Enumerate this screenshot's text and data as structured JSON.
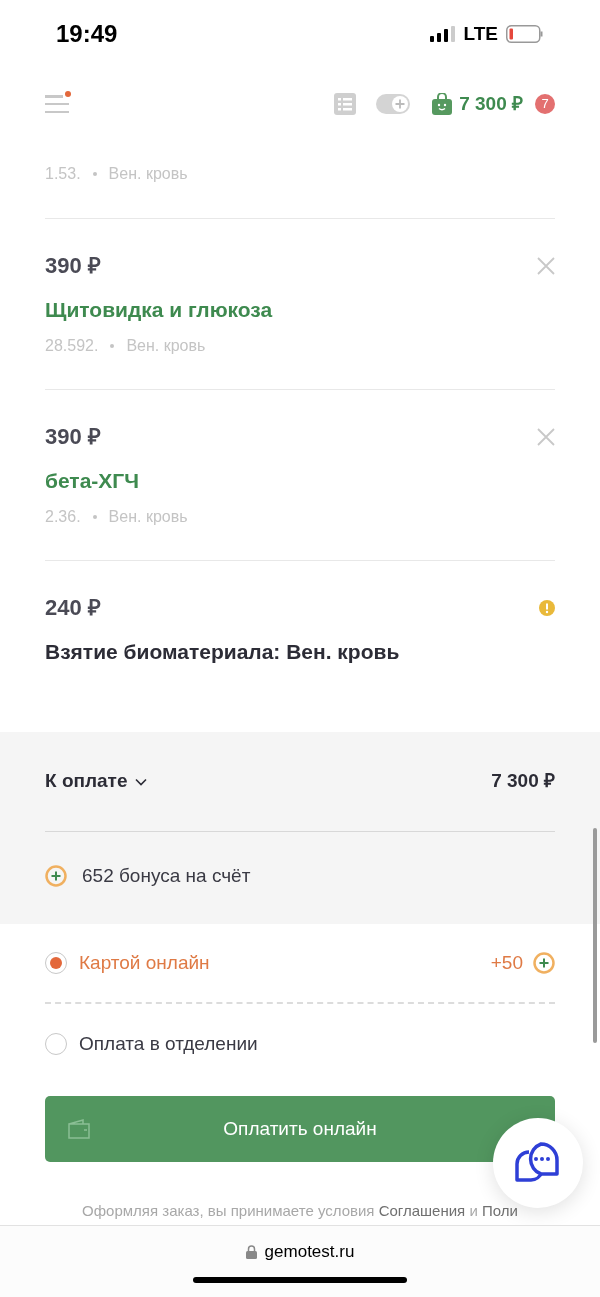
{
  "status_bar": {
    "time": "19:49",
    "network": "LTE"
  },
  "header": {
    "menu_notification": true,
    "cart_total": "7 300 ₽",
    "cart_count": "7"
  },
  "items": [
    {
      "kind": "partial",
      "code": "1.53.",
      "material": "Вен. кровь"
    },
    {
      "kind": "test",
      "price": "390 ₽",
      "title": "Щитовидка и глюкоза",
      "code": "28.592.",
      "material": "Вен. кровь"
    },
    {
      "kind": "test",
      "price": "390 ₽",
      "title": "бета-ХГЧ",
      "code": "2.36.",
      "material": "Вен. кровь"
    },
    {
      "kind": "service",
      "price": "240 ₽",
      "title": "Взятие биоматериала: Вен. кровь"
    }
  ],
  "summary": {
    "label": "К оплате",
    "total": "7 300 ₽",
    "bonus": "652 бонуса на счёт"
  },
  "payment_options": [
    {
      "label": "Картой онлайн",
      "selected": true,
      "bonus": "+50"
    },
    {
      "label": "Оплата в отделении",
      "selected": false
    }
  ],
  "pay_button": "Оплатить онлайн",
  "terms": [
    {
      "kind": "text",
      "text": "Оформляя заказ, вы принимаете условия "
    },
    {
      "kind": "link",
      "text": "Соглашения"
    },
    {
      "kind": "text",
      "text": " и "
    },
    {
      "kind": "link",
      "text": "Поли"
    }
  ],
  "url": "gemotest.ru"
}
